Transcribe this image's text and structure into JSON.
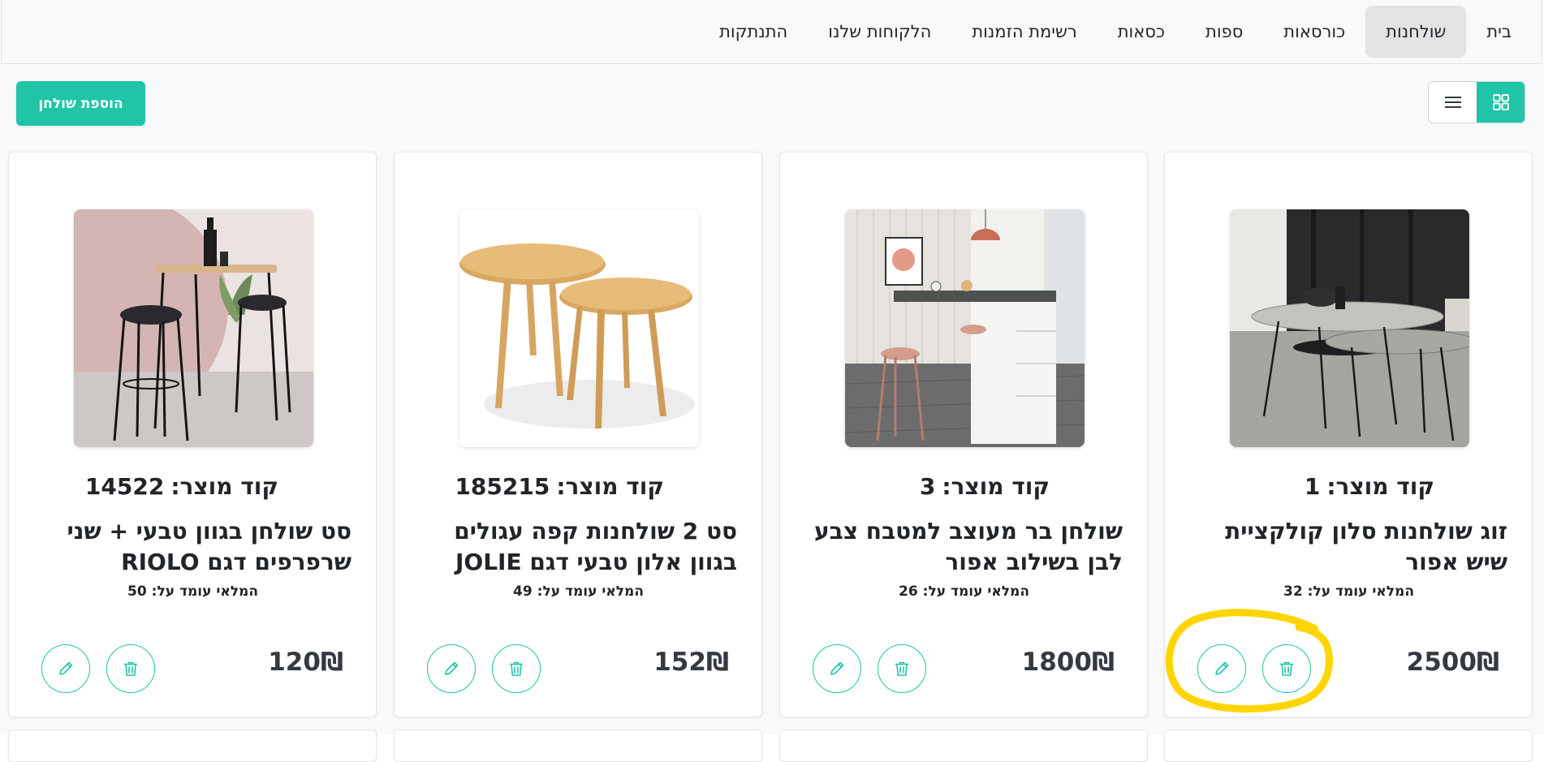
{
  "nav": {
    "items": [
      {
        "label": "בית"
      },
      {
        "label": "שולחנות"
      },
      {
        "label": "כורסאות"
      },
      {
        "label": "ספות"
      },
      {
        "label": "כסאות"
      },
      {
        "label": "רשימת הזמנות"
      },
      {
        "label": "הלקוחות שלנו"
      },
      {
        "label": "התנתקות"
      }
    ],
    "active_index": 1
  },
  "toolbar": {
    "add_label": "הוספת שולחן",
    "view_mode": "grid"
  },
  "products": [
    {
      "code_label": "קוד מוצר:",
      "code": "1",
      "title": "זוג שולחנות סלון קולקציית שיש אפור",
      "stock_label": "המלאי עומד על:",
      "stock": "32",
      "price": "2500",
      "currency": "₪"
    },
    {
      "code_label": "קוד מוצר:",
      "code": "3",
      "title": "שולחן בר מעוצב למטבח צבע לבן בשילוב אפור",
      "stock_label": "המלאי עומד על:",
      "stock": "26",
      "price": "1800",
      "currency": "₪"
    },
    {
      "code_label": "קוד מוצר:",
      "code": "185215",
      "title": "סט 2 שולחנות קפה עגולים בגוון אלון טבעי דגם JOLIE",
      "stock_label": "המלאי עומד על:",
      "stock": "49",
      "price": "152",
      "currency": "₪"
    },
    {
      "code_label": "קוד מוצר:",
      "code": "14522",
      "title": "סט שולחן בגוון טבעי + שני שרפרפים דגם RIOLO",
      "stock_label": "המלאי עומד על:",
      "stock": "50",
      "price": "120",
      "currency": "₪"
    }
  ],
  "colors": {
    "accent": "#20c5a8",
    "annotation": "#ffd500"
  },
  "icons": {
    "grid_view": "grid-view-icon",
    "list_view": "list-view-icon",
    "edit": "pencil-icon",
    "delete": "trash-icon"
  }
}
